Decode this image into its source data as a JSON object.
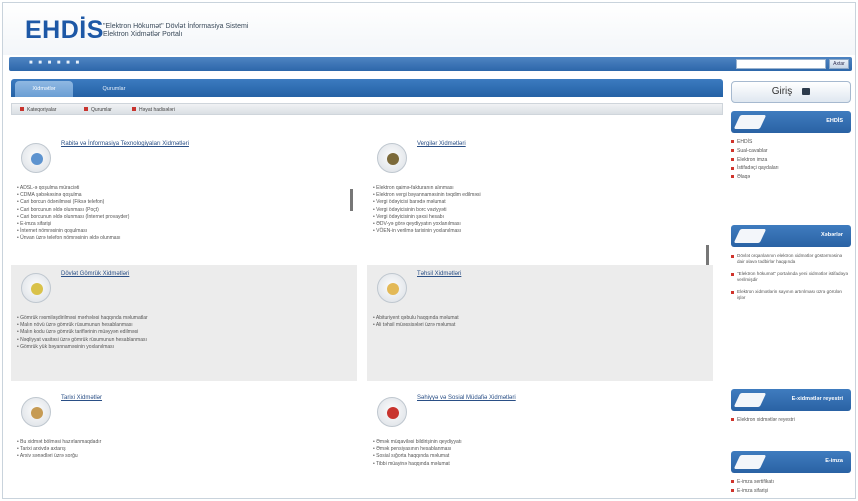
{
  "header": {
    "logo": "EHDİS",
    "subtitle_line1": "\"Elektron Hökumət\" Dövlət İnformasiya Sistemi",
    "subtitle_line2": "Elektron Xidmətlər Portalı"
  },
  "topbar": {
    "nav_text": "■ ■ ■   ■ ■ ■",
    "search_placeholder": "",
    "search_button": "Axtar"
  },
  "tabs": [
    {
      "label": "Xidmətlər"
    },
    {
      "label": "Qurumlar"
    }
  ],
  "subbar": [
    {
      "label": "Kateqoriyalar"
    },
    {
      "label": "Qurumlar"
    },
    {
      "label": "Həyat hadisələri"
    }
  ],
  "panels": [
    {
      "title": "Rabitə və İnformasiya Texnologiyaları Xidmətləri",
      "items": [
        "• ADSL-ə qoşulma müraciəti",
        "• CDMA şəbəkəsinə qoşulma",
        "• Cari borcun ödənilməsi (Fiksə telefon)",
        "• Cari borcunun əldə olunması (Poçt)",
        "• Cari borcunun əldə olunması (İnternet provayder)",
        "• E-imza sifarişi",
        "• İnternet nömrəsinin qoşulması",
        "• Ünvan üzrə telefon nömrəsinin əldə olunması"
      ]
    },
    {
      "title": "Vergilər Xidmətləri",
      "items": [
        "• Elektron qaimə-fakturanın alınması",
        "• Elektron vergi bəyannaməsinin təqdim edilməsi",
        "• Vergi ödəyicisi barədə məlumat",
        "• Vergi ödəyicisinin borc vəziyyəti",
        "• Vergi ödəyicisinin şəxsi hesabı",
        "• ƏDV-yə görə qeydiyyatın yoxlanılması",
        "• VÖEN-in verilmə tarixinin yoxlanılması"
      ]
    },
    {
      "title": "Dövlət Gömrük Xidmətləri",
      "items": [
        "• Gömrük rəsmiləşdirilməsi mərhələsi haqqında məlumatlar",
        "• Malın növü üzrə gömrük rüsumunun hesablanması",
        "• Malın kodu üzrə gömrük tariflərinin müəyyən edilməsi",
        "• Nəqliyyat vasitəsi üzrə gömrük rüsumunun hesablanması",
        "• Gömrük yük bəyannaməsinin yoxlanılması"
      ]
    },
    {
      "title": "Təhsil Xidmətləri",
      "items": [
        "• Abituriyent qəbulu haqqında məlumat",
        "• Ali təhsil müəssisələri üzrə məlumat"
      ]
    },
    {
      "title": "Tarixi Xidmətlər",
      "items": [
        "• Bu xidmət bölməsi hazırlanmaqdadır",
        "• Tarixi arxivdə axtarış",
        "• Arxiv sənədləri üzrə sorğu"
      ]
    },
    {
      "title": "Səhiyyə və Sosial Müdafiə Xidmətləri",
      "items": [
        "• Əmək müqaviləsi bildirişinin qeydiyyatı",
        "• Əmək pensiyasının hesablanması",
        "• Sosial sığorta haqqında məlumat",
        "• Tibbi müayinə haqqında məlumat"
      ]
    }
  ],
  "sidebar": {
    "login_label": "Giriş",
    "boxes": [
      {
        "title": "EHDİS",
        "items": [
          "EHDİS",
          "Sual-cavablar",
          "Elektron imza",
          "İstifadəçi qaydaları",
          "Əlaqə"
        ]
      },
      {
        "title": "Xəbərlər",
        "news": [
          "Dövlət orqanlarının elektron xidmətlər göstərməsinə dair əlavə tədbirlər haqqında",
          "\"Elektron hökumət\" portalında yeni xidmətlər istifadəyə verilmişdir",
          "Elektron xidmətlərin sayının artırılması üzrə görülən işlər"
        ]
      },
      {
        "title": "E-xidmətlər reyestri",
        "items": [
          "Elektron xidmətlər reyestri"
        ]
      },
      {
        "title": "E-imza",
        "items": [
          "E-imza sertifikatı",
          "E-imza sifarişi"
        ]
      }
    ]
  }
}
